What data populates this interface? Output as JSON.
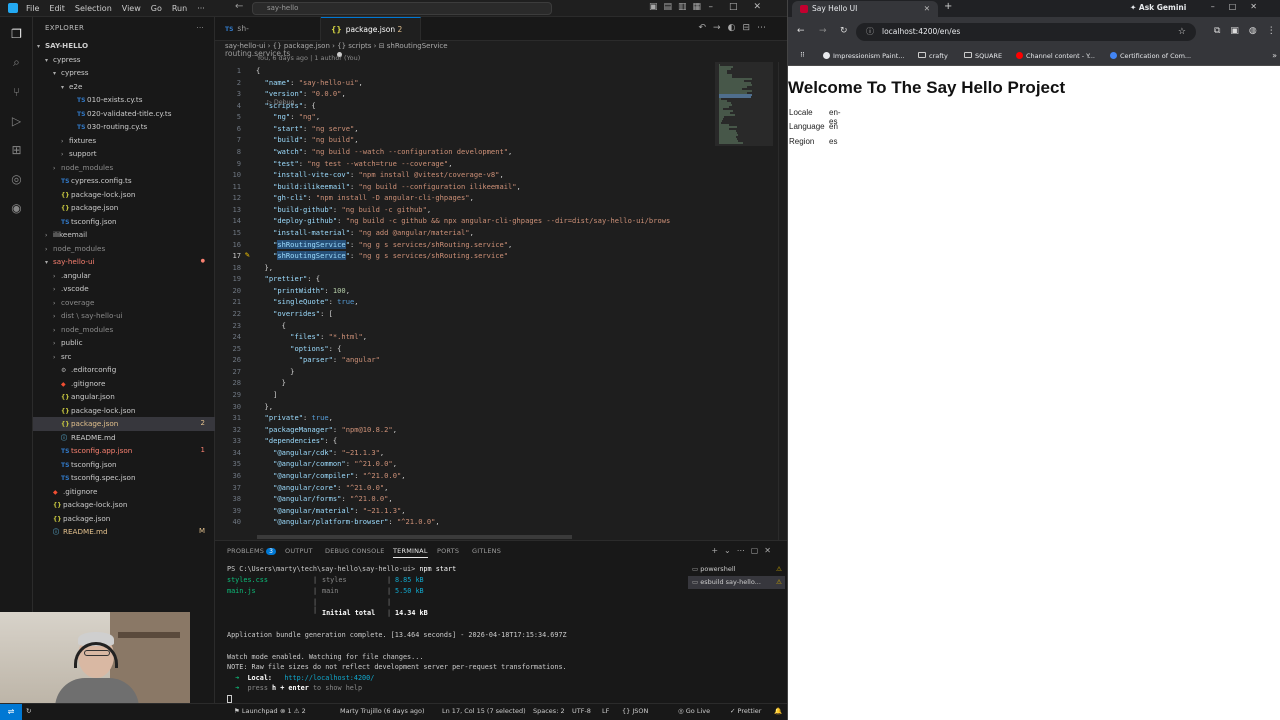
{
  "vscode": {
    "menu": [
      "File",
      "Edit",
      "Selection",
      "View",
      "Go",
      "Run"
    ],
    "command_center": "say-hello",
    "tabs": [
      {
        "label": "sh-routing.service.ts"
      },
      {
        "label": "package.json",
        "badge": "2"
      }
    ],
    "breadcrumb": "say-hello-ui  ›  {} package.json  ›  {} scripts  ›  ⊟ shRoutingService",
    "codelens": "You, 6 days ago | 1 author (You)",
    "debug_hint": "▷ Debug",
    "explorer": {
      "title": "EXPLORER",
      "root": "SAY-HELLO",
      "items": [
        {
          "label": "cypress",
          "level": 1,
          "type": "folder",
          "open": true
        },
        {
          "label": "cypress",
          "level": 2,
          "type": "folder",
          "open": true
        },
        {
          "label": "e2e",
          "level": 3,
          "type": "folder",
          "open": true
        },
        {
          "label": "010-exists.cy.ts",
          "level": 4,
          "type": "ts"
        },
        {
          "label": "020-validated-title.cy.ts",
          "level": 4,
          "type": "ts"
        },
        {
          "label": "030-routing.cy.ts",
          "level": 4,
          "type": "ts"
        },
        {
          "label": "fixtures",
          "level": 3,
          "type": "folder"
        },
        {
          "label": "support",
          "level": 3,
          "type": "folder"
        },
        {
          "label": "node_modules",
          "level": 2,
          "type": "folder",
          "dim": true
        },
        {
          "label": "cypress.config.ts",
          "level": 2,
          "type": "ts"
        },
        {
          "label": "package-lock.json",
          "level": 2,
          "type": "json"
        },
        {
          "label": "package.json",
          "level": 2,
          "type": "json"
        },
        {
          "label": "tsconfig.json",
          "level": 2,
          "type": "ts"
        },
        {
          "label": "ilikeemail",
          "level": 1,
          "type": "folder"
        },
        {
          "label": "node_modules",
          "level": 1,
          "type": "folder",
          "dim": true
        },
        {
          "label": "say-hello-ui",
          "level": 1,
          "type": "folder",
          "open": true,
          "status": "err"
        },
        {
          "label": ".angular",
          "level": 2,
          "type": "folder"
        },
        {
          "label": ".vscode",
          "level": 2,
          "type": "folder"
        },
        {
          "label": "coverage",
          "level": 2,
          "type": "folder",
          "dim": true
        },
        {
          "label": "dist \\ say-hello-ui",
          "level": 2,
          "type": "folder",
          "dim": true
        },
        {
          "label": "node_modules",
          "level": 2,
          "type": "folder",
          "dim": true
        },
        {
          "label": "public",
          "level": 2,
          "type": "folder"
        },
        {
          "label": "src",
          "level": 2,
          "type": "folder"
        },
        {
          "label": ".editorconfig",
          "level": 2,
          "type": "cfg"
        },
        {
          "label": ".gitignore",
          "level": 2,
          "type": "git"
        },
        {
          "label": "angular.json",
          "level": 2,
          "type": "json"
        },
        {
          "label": "package-lock.json",
          "level": 2,
          "type": "json"
        },
        {
          "label": "package.json",
          "level": 2,
          "type": "json",
          "selected": true,
          "badge": "2",
          "status": "mod"
        },
        {
          "label": "README.md",
          "level": 2,
          "type": "md"
        },
        {
          "label": "tsconfig.app.json",
          "level": 2,
          "type": "ts",
          "badge": "1",
          "status": "err"
        },
        {
          "label": "tsconfig.json",
          "level": 2,
          "type": "ts"
        },
        {
          "label": "tsconfig.spec.json",
          "level": 2,
          "type": "ts"
        },
        {
          "label": ".gitignore",
          "level": 1,
          "type": "git"
        },
        {
          "label": "package-lock.json",
          "level": 1,
          "type": "json"
        },
        {
          "label": "package.json",
          "level": 1,
          "type": "json"
        },
        {
          "label": "README.md",
          "level": 1,
          "type": "md",
          "badge": "M",
          "status": "mod"
        }
      ]
    },
    "code_lines": [
      {
        "n": "1",
        "t": "{"
      },
      {
        "n": "2",
        "t": "  \"name\": \"say-hello-ui\","
      },
      {
        "n": "3",
        "t": "  \"version\": \"0.0.0\","
      },
      {
        "n": "4",
        "t": "  \"scripts\": {"
      },
      {
        "n": "5",
        "t": "    \"ng\": \"ng\","
      },
      {
        "n": "6",
        "t": "    \"start\": \"ng serve\","
      },
      {
        "n": "7",
        "t": "    \"build\": \"ng build\","
      },
      {
        "n": "8",
        "t": "    \"watch\": \"ng build --watch --configuration development\","
      },
      {
        "n": "9",
        "t": "    \"test\": \"ng test --watch=true --coverage\","
      },
      {
        "n": "10",
        "t": "    \"install-vite-cov\": \"npm install @vitest/coverage-v8\","
      },
      {
        "n": "11",
        "t": "    \"build:ilikeemail\": \"ng build --configuration ilikeemail\","
      },
      {
        "n": "12",
        "t": "    \"gh-cli\": \"npm install -D angular-cli-ghpages\","
      },
      {
        "n": "13",
        "t": "    \"build-github\": \"ng build -c github\","
      },
      {
        "n": "14",
        "t": "    \"deploy-github\": \"ng build -c github && npx angular-cli-ghpages --dir=dist/say-hello-ui/brows"
      },
      {
        "n": "15",
        "t": "    \"install-material\": \"ng add @angular/material\","
      },
      {
        "n": "16",
        "t": "    \"shRoutingService\": \"ng g s services/shRouting.service\","
      },
      {
        "n": "17",
        "t": "    \"shRoutingService\": \"ng g s services/shRouting.service\""
      },
      {
        "n": "18",
        "t": "  },"
      },
      {
        "n": "19",
        "t": "  \"prettier\": {"
      },
      {
        "n": "20",
        "t": "    \"printWidth\": 100,"
      },
      {
        "n": "21",
        "t": "    \"singleQuote\": true,"
      },
      {
        "n": "22",
        "t": "    \"overrides\": ["
      },
      {
        "n": "23",
        "t": "      {"
      },
      {
        "n": "24",
        "t": "        \"files\": \"*.html\","
      },
      {
        "n": "25",
        "t": "        \"options\": {"
      },
      {
        "n": "26",
        "t": "          \"parser\": \"angular\""
      },
      {
        "n": "27",
        "t": "        }"
      },
      {
        "n": "28",
        "t": "      }"
      },
      {
        "n": "29",
        "t": "    ]"
      },
      {
        "n": "30",
        "t": "  },"
      },
      {
        "n": "31",
        "t": "  \"private\": true,"
      },
      {
        "n": "32",
        "t": "  \"packageManager\": \"npm@10.8.2\","
      },
      {
        "n": "33",
        "t": "  \"dependencies\": {"
      },
      {
        "n": "34",
        "t": "    \"@angular/cdk\": \"~21.1.3\","
      },
      {
        "n": "35",
        "t": "    \"@angular/common\": \"^21.0.0\","
      },
      {
        "n": "36",
        "t": "    \"@angular/compiler\": \"^21.0.0\","
      },
      {
        "n": "37",
        "t": "    \"@angular/core\": \"^21.0.0\","
      },
      {
        "n": "38",
        "t": "    \"@angular/forms\": \"^21.0.0\","
      },
      {
        "n": "39",
        "t": "    \"@angular/material\": \"~21.1.3\","
      },
      {
        "n": "40",
        "t": "    \"@angular/platform-browser\": \"^21.0.0\","
      }
    ],
    "panel": {
      "tabs": [
        {
          "label": "PROBLEMS",
          "badge": "3"
        },
        {
          "label": "OUTPUT"
        },
        {
          "label": "DEBUG CONSOLE"
        },
        {
          "label": "TERMINAL",
          "active": true
        },
        {
          "label": "PORTS"
        },
        {
          "label": "GITLENS"
        }
      ],
      "terminal_list": [
        {
          "label": "powershell"
        },
        {
          "label": "esbuild  say-hello...",
          "selected": true
        }
      ],
      "terminal": {
        "prompt": "PS C:\\Users\\marty\\tech\\say-hello\\say-hello-ui> ",
        "command": "npm start",
        "files": [
          {
            "name": "styles.css",
            "sep": "|",
            "label": "styles",
            "size": "8.85 kB"
          },
          {
            "name": "main.js",
            "sep": "|",
            "label": "main",
            "size": "5.50 kB"
          }
        ],
        "initial_total_label": "Initial total",
        "initial_total": "14.34 kB",
        "generation": "Application bundle generation complete. [13.464 seconds] - 2026-04-18T17:15:34.697Z",
        "watch": "Watch mode enabled. Watching for file changes...",
        "note": "NOTE: Raw file sizes do not reflect development server per-request transformations.",
        "local_label": "Local:",
        "local_url": "http://localhost:4200/",
        "help_prefix": "press ",
        "help_key": "h + enter",
        "help_suffix": " to show help"
      }
    },
    "statusbar": {
      "launchpad": "Launchpad",
      "problems": "⊗ 1 ⚠ 2",
      "blame": "Marty Trujillo (6 days ago)",
      "position": "Ln 17, Col 15 (7 selected)",
      "spaces": "Spaces: 2",
      "encoding": "UTF-8",
      "eol": "LF",
      "language": "{} JSON",
      "golive": "Go Live",
      "prettier": "✓ Prettier"
    }
  },
  "browser": {
    "tab_title": "Say Hello UI",
    "ask_gemini": "Ask Gemini",
    "url": "localhost:4200/en/es",
    "bookmarks": [
      {
        "label": "Impressionism Paint...",
        "icon": "circle",
        "color": "#e8eaed"
      },
      {
        "label": "crafty",
        "icon": "folder"
      },
      {
        "label": "SQUARE",
        "icon": "folder"
      },
      {
        "label": "Channel content - Y...",
        "icon": "circle",
        "color": "#ff0000"
      },
      {
        "label": "Certification of Com...",
        "icon": "circle",
        "color": "#4285f4"
      }
    ],
    "page": {
      "title": "Welcome To The Say Hello Project",
      "rows": [
        {
          "label": "Locale",
          "value": "en-es"
        },
        {
          "label": "Language",
          "value": "en"
        },
        {
          "label": "Region",
          "value": "es"
        }
      ]
    }
  }
}
